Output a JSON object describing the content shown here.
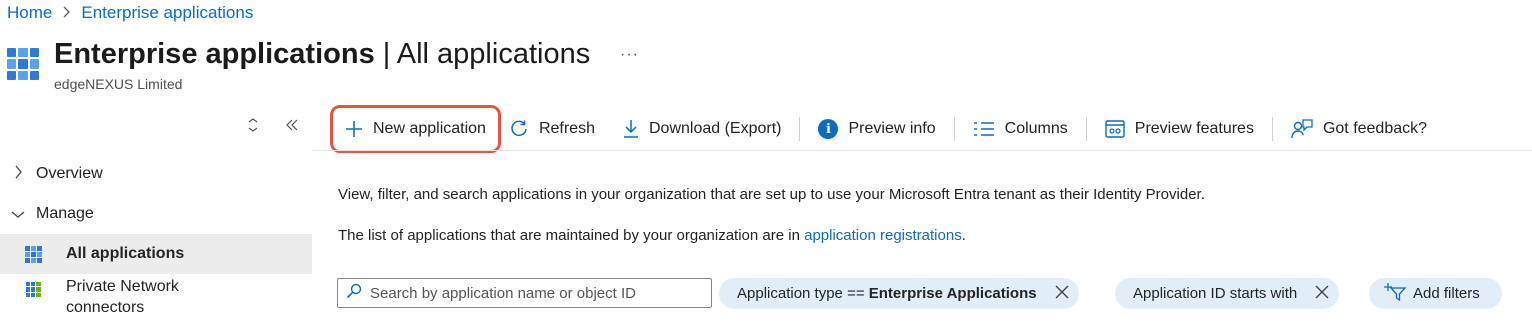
{
  "breadcrumb": {
    "home": "Home",
    "current": "Enterprise applications",
    "separator": ">"
  },
  "header": {
    "title_main": "Enterprise applications",
    "title_sep": " | ",
    "title_sub": "All applications",
    "subtitle": "edgeNEXUS Limited",
    "more": "···"
  },
  "collapse": {
    "expand": "⌃⌄",
    "collapse": "«"
  },
  "sidebar": {
    "items": [
      {
        "label": "Overview",
        "chevron": ">"
      },
      {
        "label": "Manage",
        "chevron": "∨"
      },
      {
        "label": "All applications",
        "active": true
      },
      {
        "label": "Private Network connectors"
      }
    ]
  },
  "toolbar": {
    "new_application": "New application",
    "refresh": "Refresh",
    "download": "Download (Export)",
    "preview_info": "Preview info",
    "columns": "Columns",
    "preview_features": "Preview features",
    "feedback": "Got feedback?"
  },
  "content": {
    "description": "View, filter, and search applications in your organization that are set up to use your Microsoft Entra tenant as their Identity Provider.",
    "list_text": "The list of applications that are maintained by your organization are in ",
    "list_link": "application registrations",
    "list_end": "."
  },
  "filters": {
    "search_placeholder": "Search by application name or object ID",
    "pill1_label": "Application type ==",
    "pill1_value": "Enterprise Applications",
    "pill2_label": "Application ID starts with",
    "add_filters": "Add filters"
  },
  "colors": {
    "accent": "#0f6cbd",
    "highlight": "#e2534a",
    "pill_bg": "#e1eef9"
  },
  "icons": [
    "grid-app-icon",
    "plus-icon",
    "refresh-icon",
    "download-icon",
    "info-icon",
    "columns-icon",
    "preview-features-icon",
    "feedback-icon",
    "search-icon",
    "close-icon",
    "add-filter-icon"
  ]
}
